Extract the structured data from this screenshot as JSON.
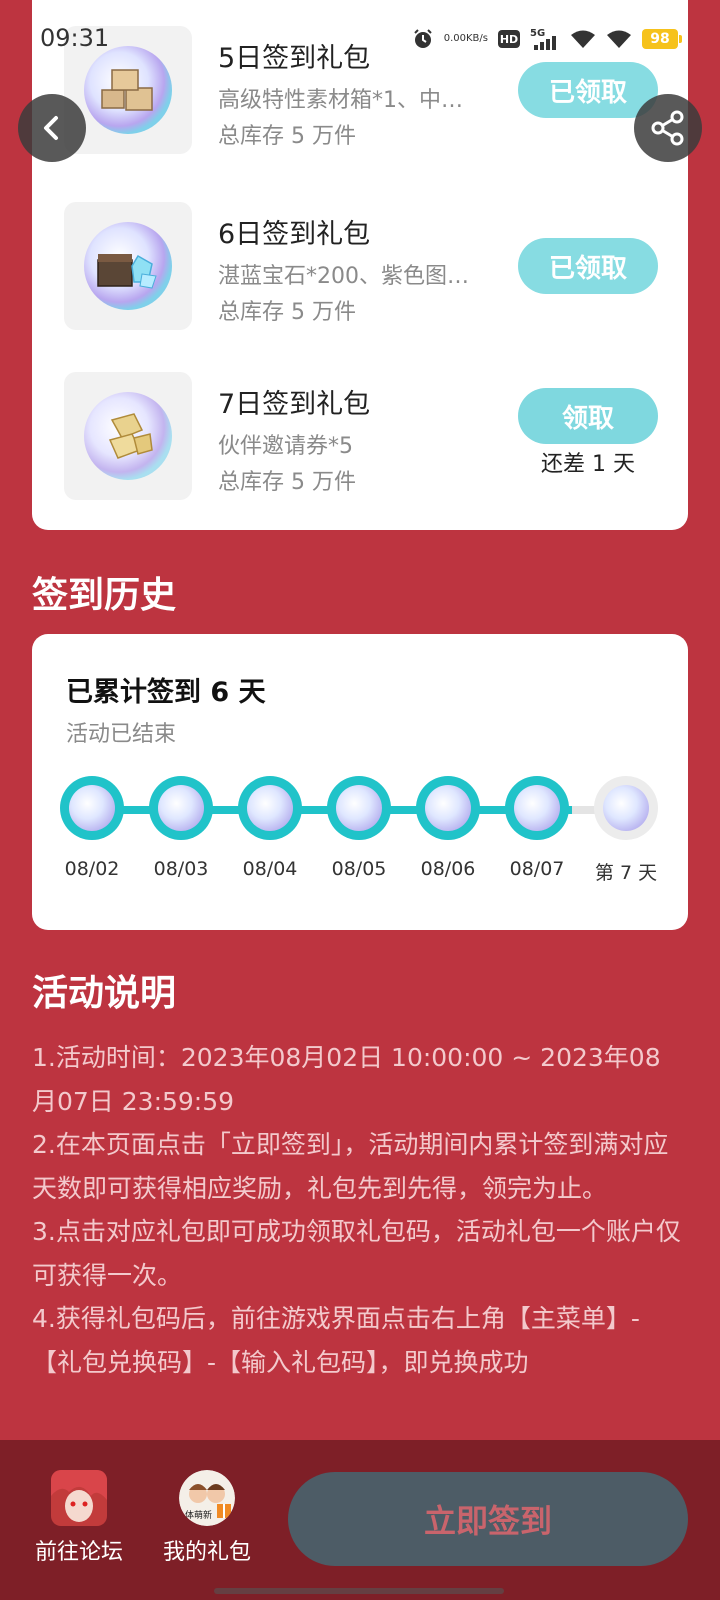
{
  "status_bar": {
    "time": "09:31",
    "net_speed_value": "0.00",
    "net_speed_unit": "KB/s",
    "hd": "HD",
    "signal": "5G",
    "battery": "98"
  },
  "gifts": [
    {
      "title": "5日签到礼包",
      "desc": "高级特性素材箱*1、中…",
      "stock": "总库存 5 万件",
      "button": "已领取",
      "icon": "supply-crates-icon"
    },
    {
      "title": "6日签到礼包",
      "desc": "湛蓝宝石*200、紫色图…",
      "stock": "总库存 5 万件",
      "button": "已领取",
      "icon": "gem-chest-icon"
    },
    {
      "title": "7日签到礼包",
      "desc": "伙伴邀请券*5",
      "stock": "总库存 5 万件",
      "button": "领取",
      "remaining": "还差 1 天",
      "icon": "gold-ticket-icon"
    }
  ],
  "history": {
    "heading": "签到历史",
    "count": "已累计签到 6 天",
    "status": "活动已结束",
    "days": [
      {
        "label": "08/02",
        "done": true
      },
      {
        "label": "08/03",
        "done": true
      },
      {
        "label": "08/04",
        "done": true
      },
      {
        "label": "08/05",
        "done": true
      },
      {
        "label": "08/06",
        "done": true
      },
      {
        "label": "08/07",
        "done": true
      },
      {
        "label": "第 7 天",
        "done": false
      }
    ]
  },
  "rules": {
    "heading": "活动说明",
    "lines": [
      "1.活动时间：2023年08月02日 10:00:00 ~ 2023年08月07日 23:59:59",
      "2.在本页面点击「立即签到」，活动期间内累计签到满对应天数即可获得相应奖励，礼包先到先得，领完为止。",
      "3.点击对应礼包即可成功领取礼包码，活动礼包一个账户仅可获得一次。",
      "4.获得礼包码后，前往游戏界面点击右上角【主菜单】-【礼包兑换码】-【输入礼包码】，即兑换成功"
    ]
  },
  "bottom_bar": {
    "forum": "前往论坛",
    "my_gifts": "我的礼包",
    "my_gifts_badge": "体萌新",
    "checkin": "立即签到"
  },
  "colors": {
    "page_bg": "#bd3440",
    "accent_teal": "#20c3c9",
    "claimed_button": "#87dce2",
    "bottom_bar": "#7e1f27",
    "checkin_button": "#4d5c66"
  }
}
